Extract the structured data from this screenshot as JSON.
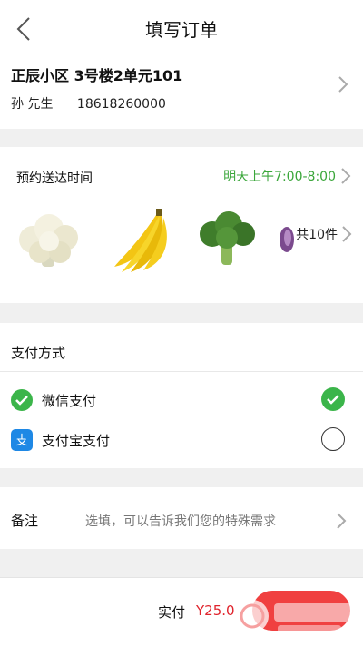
{
  "navbar": {
    "title": "填写订单"
  },
  "address": {
    "line": "正辰小区 3号楼2单元101",
    "name": "孙 先生",
    "phone": "18618260000"
  },
  "delivery": {
    "label": "预约送达时间",
    "time": "明天上午7:00-8:00",
    "items": [
      "cauliflower",
      "banana",
      "broccoli",
      "purple-cabbage"
    ],
    "count_label": "共10件"
  },
  "payment": {
    "title": "支付方式",
    "options": [
      {
        "label": "微信支付",
        "icon": "wechat-pay-icon",
        "selected": true
      },
      {
        "label": "支付宝支付",
        "icon": "alipay-icon",
        "selected": false
      }
    ]
  },
  "note": {
    "label": "备注",
    "placeholder": "选填，可以告诉我们您的特殊需求"
  },
  "footer": {
    "total_label": "实付",
    "total_amount": "Y25.0"
  },
  "colors": {
    "accent_green": "#3aa63a",
    "price_red": "#e0242d",
    "button_red": "#f04040"
  }
}
